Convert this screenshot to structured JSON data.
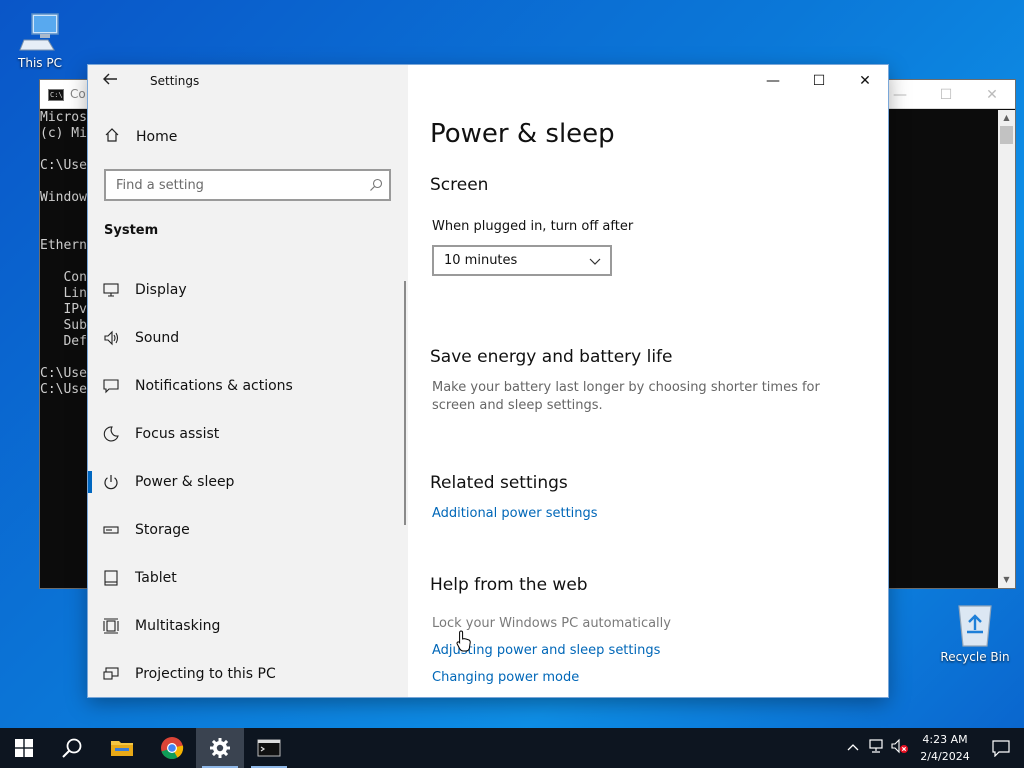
{
  "desktop": {
    "this_pc": "This PC",
    "recycle_bin": "Recycle Bin"
  },
  "console": {
    "title": "Co",
    "lines": "Micros\n(c) Mi\n\nC:\\Use\n\nWindow\n\n\nEthern\n\n   Con\n   Lin\n   IPv\n   Sub\n   Def\n\nC:\\Use\nC:\\Use"
  },
  "settings": {
    "app_title": "Settings",
    "home_label": "Home",
    "search_placeholder": "Find a setting",
    "section": "System",
    "nav_items": [
      {
        "label": "Display",
        "icon": "display-icon"
      },
      {
        "label": "Sound",
        "icon": "sound-icon"
      },
      {
        "label": "Notifications & actions",
        "icon": "notifications-icon"
      },
      {
        "label": "Focus assist",
        "icon": "moon-icon"
      },
      {
        "label": "Power & sleep",
        "icon": "power-icon",
        "active": true
      },
      {
        "label": "Storage",
        "icon": "storage-icon"
      },
      {
        "label": "Tablet",
        "icon": "tablet-icon"
      },
      {
        "label": "Multitasking",
        "icon": "multitasking-icon"
      },
      {
        "label": "Projecting to this PC",
        "icon": "projecting-icon"
      }
    ],
    "page_title": "Power & sleep",
    "screen_heading": "Screen",
    "plugged_label": "When plugged in, turn off after",
    "plugged_value": "10 minutes",
    "save_heading": "Save energy and battery life",
    "save_desc": "Make your battery last longer by choosing shorter times for screen and sleep settings.",
    "related_heading": "Related settings",
    "related_link": "Additional power settings",
    "help_heading": "Help from the web",
    "help_items": [
      "Lock your Windows PC automatically",
      "Adjusting power and sleep settings",
      "Changing power mode"
    ]
  },
  "taskbar": {
    "time": "4:23 AM",
    "date": "2/4/2024"
  },
  "colors": {
    "accent": "#0067c0",
    "link": "#0067b8",
    "taskbar": "#0d1520"
  }
}
